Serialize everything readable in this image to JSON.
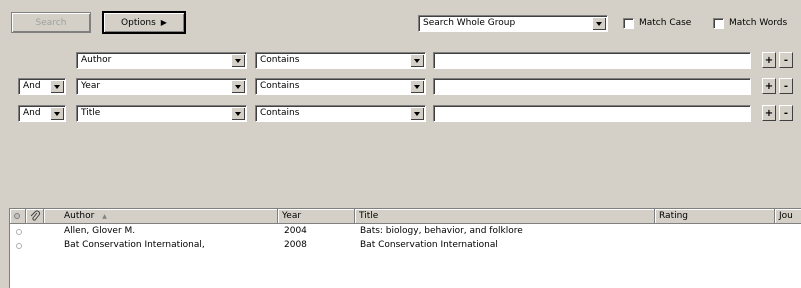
{
  "toolbar": {
    "search_label": "Search",
    "options_label": "Options",
    "options_arrow": "▶",
    "scope_value": "Search Whole Group",
    "match_case_label": "Match Case",
    "match_words_label": "Match Words"
  },
  "criteria": [
    {
      "bool": "",
      "field": "Author",
      "op": "Contains",
      "value": ""
    },
    {
      "bool": "And",
      "field": "Year",
      "op": "Contains",
      "value": ""
    },
    {
      "bool": "And",
      "field": "Title",
      "op": "Contains",
      "value": ""
    }
  ],
  "buttons": {
    "plus": "+",
    "minus": "-"
  },
  "results": {
    "columns": {
      "author": "Author",
      "sort_indicator": "▲",
      "year": "Year",
      "title": "Title",
      "rating": "Rating",
      "journal": "Jou"
    },
    "rows": [
      {
        "author": "Allen, Glover M.",
        "year": "2004",
        "title": "Bats: biology, behavior, and folklore"
      },
      {
        "author": "Bat Conservation International,",
        "year": "2008",
        "title": "Bat Conservation International"
      }
    ]
  }
}
